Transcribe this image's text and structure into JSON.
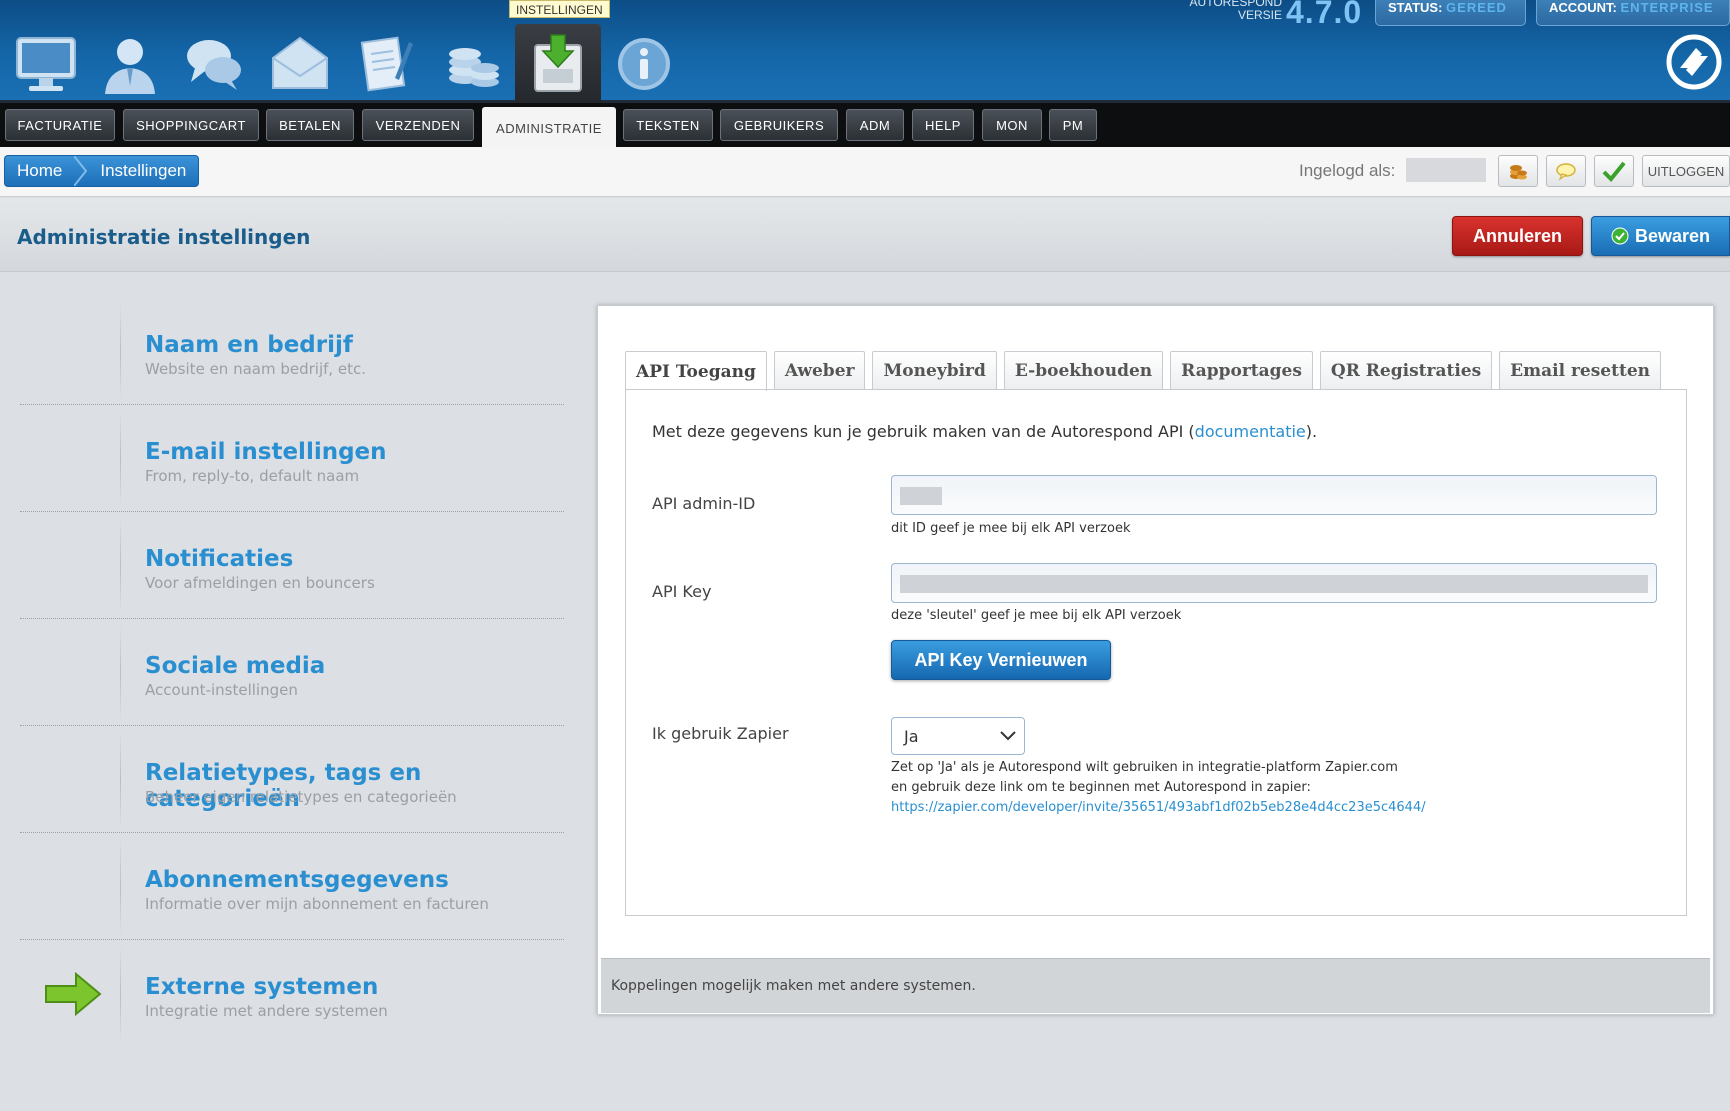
{
  "header": {
    "tooltip": "INSTELLINGEN",
    "version_label_1": "AUTORESPOND",
    "version_label_2": "VERSIE",
    "version": "4.7.0",
    "status_label": "STATUS:",
    "status_value": "GEREED",
    "account_label": "ACCOUNT:",
    "account_value": "ENTERPRISE",
    "icons": [
      "monitor-icon",
      "user-icon",
      "chat-icon",
      "envelope-icon",
      "document-icon",
      "coins-icon",
      "settings-download-icon",
      "info-icon"
    ]
  },
  "nav": {
    "items": [
      "FACTURATIE",
      "SHOPPINGCART",
      "BETALEN",
      "VERZENDEN",
      "ADMINISTRATIE",
      "TEKSTEN",
      "GEBRUIKERS",
      "ADM",
      "HELP",
      "MON",
      "PM"
    ],
    "active": "ADMINISTRATIE"
  },
  "breadcrumb": {
    "home": "Home",
    "current": "Instellingen"
  },
  "user": {
    "logged_in_label": "Ingelogd als:",
    "logout": "UITLOGGEN"
  },
  "page": {
    "title": "Administratie instellingen",
    "cancel": "Annuleren",
    "save": "Bewaren"
  },
  "menu": [
    {
      "title": "Naam en bedrijf",
      "subtitle": "Website en naam bedrijf, etc."
    },
    {
      "title": "E-mail instellingen",
      "subtitle": "From, reply-to, default naam"
    },
    {
      "title": "Notificaties",
      "subtitle": "Voor afmeldingen en bouncers"
    },
    {
      "title": "Sociale media",
      "subtitle": "Account-instellingen"
    },
    {
      "title": "Relatietypes, tags en categorieën",
      "subtitle": "Beheer eigen relatietypes en categorieën"
    },
    {
      "title": "Abonnementsgegevens",
      "subtitle": "Informatie over mijn abonnement en facturen"
    },
    {
      "title": "Externe systemen",
      "subtitle": "Integratie met andere systemen"
    }
  ],
  "tabs": [
    "API Toegang",
    "Aweber",
    "Moneybird",
    "E-boekhouden",
    "Rapportages",
    "QR Registraties",
    "Email resetten"
  ],
  "api": {
    "intro_before": "Met deze gegevens kun je gebruik maken van de Autorespond API (",
    "intro_link": "documentatie",
    "intro_after": ").",
    "admin_id_label": "API admin-ID",
    "admin_id_help": "dit ID geef je mee bij elk API verzoek",
    "key_label": "API Key",
    "key_help": "deze 'sleutel' geef je mee bij elk API verzoek",
    "renew_button": "API Key Vernieuwen",
    "zapier_label": "Ik gebruik Zapier",
    "zapier_value": "Ja",
    "zapier_help_1": "Zet op 'Ja' als je Autorespond wilt gebruiken in integratie-platform Zapier.com",
    "zapier_help_2": "en gebruik deze link om te beginnen met Autorespond in zapier:",
    "zapier_link": "https://zapier.com/developer/invite/35651/493abf1df02b5eb28e4d4cc23e5c4644/"
  },
  "footer": {
    "text": "Koppelingen mogelijk maken met andere systemen."
  }
}
